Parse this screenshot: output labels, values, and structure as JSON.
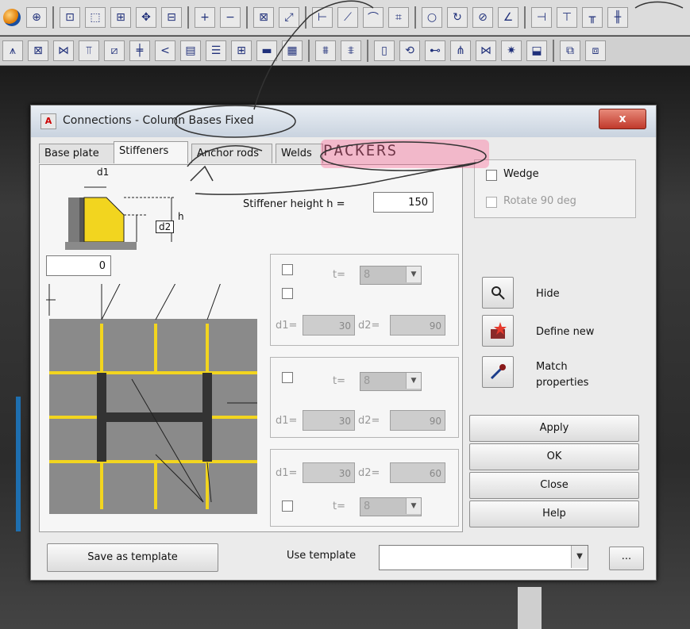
{
  "dialog": {
    "title": "Connections - Column Bases Fixed",
    "close_glyph": "x"
  },
  "tabs": [
    {
      "label": "Base plate",
      "active": false
    },
    {
      "label": "Stiffeners",
      "active": true
    },
    {
      "label": "Anchor rods",
      "active": false
    },
    {
      "label": "Welds",
      "active": false
    }
  ],
  "annotation": {
    "packers": "PACKERS",
    "color": "#ff5a8c"
  },
  "stiffener": {
    "height_label": "Stiffener height h =",
    "height_value": "150",
    "offset_value": "0",
    "diagram_labels": {
      "d1": "d1",
      "d2": "d2",
      "h": "h"
    }
  },
  "groups": [
    {
      "t_label": "t=",
      "t_value": "8",
      "d1_label": "d1=",
      "d1_value": "30",
      "d2_label": "d2=",
      "d2_value": "90"
    },
    {
      "t_label": "t=",
      "t_value": "8",
      "d1_label": "d1=",
      "d1_value": "30",
      "d2_label": "d2=",
      "d2_value": "90"
    },
    {
      "t_label": "t=",
      "t_value": "8",
      "d1_label": "d1=",
      "d1_value": "30",
      "d2_label": "d2=",
      "d2_value": "60"
    }
  ],
  "options": {
    "wedge_label": "Wedge",
    "rotate_label": "Rotate 90 deg"
  },
  "actions": {
    "hide": "Hide",
    "define_new": "Define new",
    "match_line1": "Match",
    "match_line2": "properties",
    "apply": "Apply",
    "ok": "OK",
    "close": "Close",
    "help": "Help"
  },
  "footer": {
    "save_template": "Save as template",
    "use_template": "Use template",
    "template_value": "",
    "browse": "..."
  },
  "colors": {
    "stiffener_yellow": "#f2d51f",
    "plate_gray": "#8a8a8a",
    "close_red": "#c0392b"
  }
}
